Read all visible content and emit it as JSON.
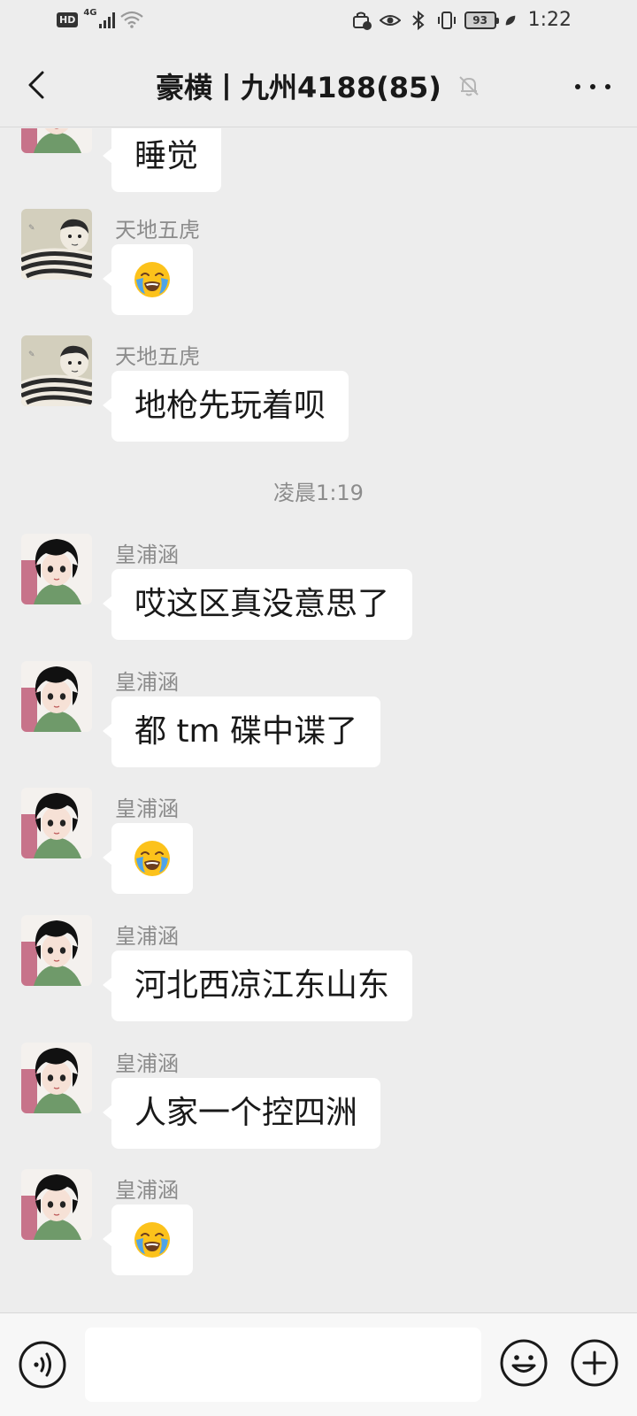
{
  "status_bar": {
    "hd": "HD",
    "network": "4G",
    "battery": "93",
    "time": "1:22"
  },
  "header": {
    "title": "豪横丨九州4188(85)",
    "back_icon": "chevron-left-icon",
    "mute_icon": "bell-off-icon",
    "more_icon": "ellipsis-icon"
  },
  "messages": [
    {
      "sender": "",
      "text": "睡觉",
      "avatar": "cartoon-boy"
    },
    {
      "sender": "天地五虎",
      "emoji": "loudly-crying-face",
      "avatar": "baby-photo"
    },
    {
      "sender": "天地五虎",
      "text": "地枪先玩着呗",
      "avatar": "baby-photo"
    },
    {
      "sender": "皇浦涵",
      "text": "哎这区真没意思了",
      "avatar": "cartoon-boy"
    },
    {
      "sender": "皇浦涵",
      "text": "都 tm 碟中谍了",
      "avatar": "cartoon-boy"
    },
    {
      "sender": "皇浦涵",
      "emoji": "loudly-crying-face",
      "avatar": "cartoon-boy"
    },
    {
      "sender": "皇浦涵",
      "text": "河北西凉江东山东",
      "avatar": "cartoon-boy"
    },
    {
      "sender": "皇浦涵",
      "text": "人家一个控四洲",
      "avatar": "cartoon-boy"
    },
    {
      "sender": "皇浦涵",
      "emoji": "loudly-crying-face",
      "avatar": "cartoon-boy"
    }
  ],
  "timestamp": "凌晨1:19",
  "input_bar": {
    "voice_icon": "voice-icon",
    "emoji_icon": "smiley-icon",
    "plus_icon": "plus-circle-icon",
    "value": ""
  },
  "colors": {
    "background": "#ededed",
    "bubble": "#ffffff",
    "sender_text": "#8c8c8c",
    "primary_text": "#191919"
  }
}
